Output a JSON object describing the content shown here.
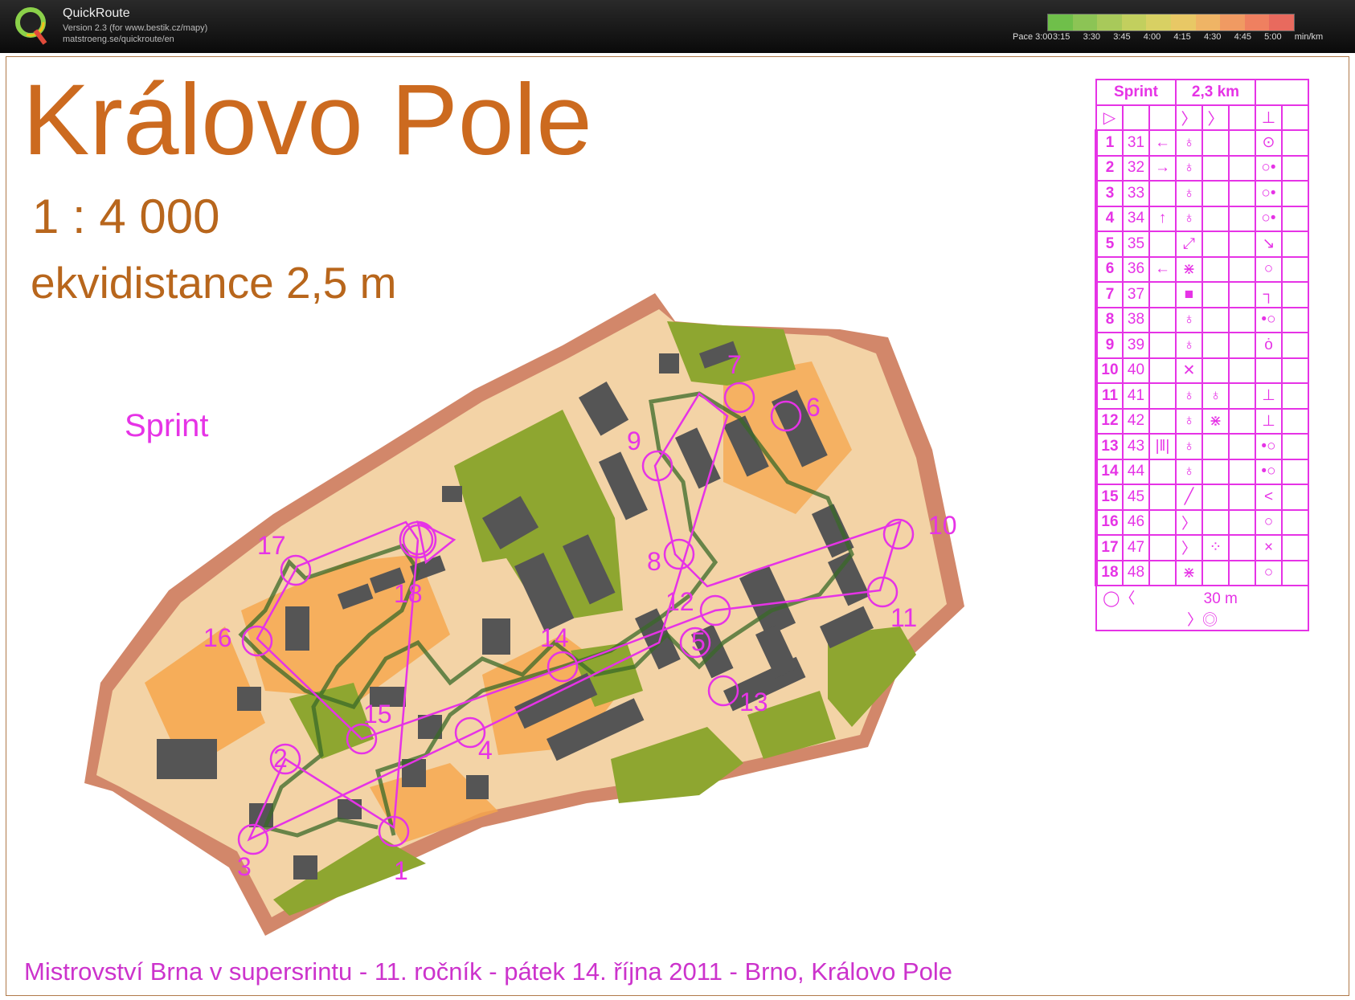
{
  "app": {
    "name": "QuickRoute",
    "version_line": "Version 2.3  (for www.bestik.cz/mapy)",
    "url_line": "matstroeng.se/quickroute/en"
  },
  "pace": {
    "labels": [
      "Pace 3:00",
      "3:15",
      "3:30",
      "3:45",
      "4:00",
      "4:15",
      "4:30",
      "4:45",
      "5:00",
      "min/km"
    ],
    "colors": [
      "#6fbf4a",
      "#8cc455",
      "#a8c95a",
      "#c2cf5e",
      "#d8d063",
      "#e8c865",
      "#efb465",
      "#f09a62",
      "#ef8060",
      "#e86a5e"
    ]
  },
  "map": {
    "title": "Královo Pole",
    "scale": "1 : 4 000",
    "contour_interval": "ekvidistance 2,5 m",
    "course_name": "Sprint",
    "footer": "Mistrovství Brna v supersrintu - 11. ročník - pátek 14. října 2011 - Brno, Královo Pole",
    "control_numbers": [
      "1",
      "2",
      "3",
      "4",
      "5",
      "6",
      "7",
      "8",
      "9",
      "10",
      "11",
      "12",
      "13",
      "14",
      "15",
      "16",
      "17",
      "18"
    ]
  },
  "description_sheet": {
    "course": "Sprint",
    "length": "2,3 km",
    "controls": [
      {
        "seq": "1",
        "code": "31",
        "dir": "←",
        "feature": "♁",
        "place": "⊙"
      },
      {
        "seq": "2",
        "code": "32",
        "dir": "→",
        "feature": "♁",
        "place": "○•"
      },
      {
        "seq": "3",
        "code": "33",
        "dir": "",
        "feature": "♁",
        "place": "○•"
      },
      {
        "seq": "4",
        "code": "34",
        "dir": "↑",
        "feature": "♁",
        "place": "○•"
      },
      {
        "seq": "5",
        "code": "35",
        "dir": "",
        "feature": "⤢",
        "place": "↘"
      },
      {
        "seq": "6",
        "code": "36",
        "dir": "←",
        "feature": "⋇",
        "place": "○"
      },
      {
        "seq": "7",
        "code": "37",
        "dir": "",
        "feature": "■",
        "place": "┐"
      },
      {
        "seq": "8",
        "code": "38",
        "dir": "",
        "feature": "♁",
        "place": "•○"
      },
      {
        "seq": "9",
        "code": "39",
        "dir": "",
        "feature": "♁",
        "place": "ȯ"
      },
      {
        "seq": "10",
        "code": "40",
        "dir": "",
        "feature": "✕",
        "place": ""
      },
      {
        "seq": "11",
        "code": "41",
        "dir": "",
        "feature": "♁",
        "feature2": "♁",
        "place": "⊥"
      },
      {
        "seq": "12",
        "code": "42",
        "dir": "",
        "feature": "♁",
        "feature2": "⋇",
        "place": "⊥"
      },
      {
        "seq": "13",
        "code": "43",
        "dir": "|‖|",
        "feature": "♁",
        "place": "•○"
      },
      {
        "seq": "14",
        "code": "44",
        "dir": "",
        "feature": "♁",
        "place": "•○"
      },
      {
        "seq": "15",
        "code": "45",
        "dir": "",
        "feature": "╱",
        "place": "<"
      },
      {
        "seq": "16",
        "code": "46",
        "dir": "",
        "feature": "〉",
        "place": "○"
      },
      {
        "seq": "17",
        "code": "47",
        "dir": "",
        "feature": "〉",
        "feature2": "⁘",
        "place": "×"
      },
      {
        "seq": "18",
        "code": "48",
        "dir": "",
        "feature": "⋇",
        "place": "○"
      }
    ],
    "finish": "30 m"
  }
}
